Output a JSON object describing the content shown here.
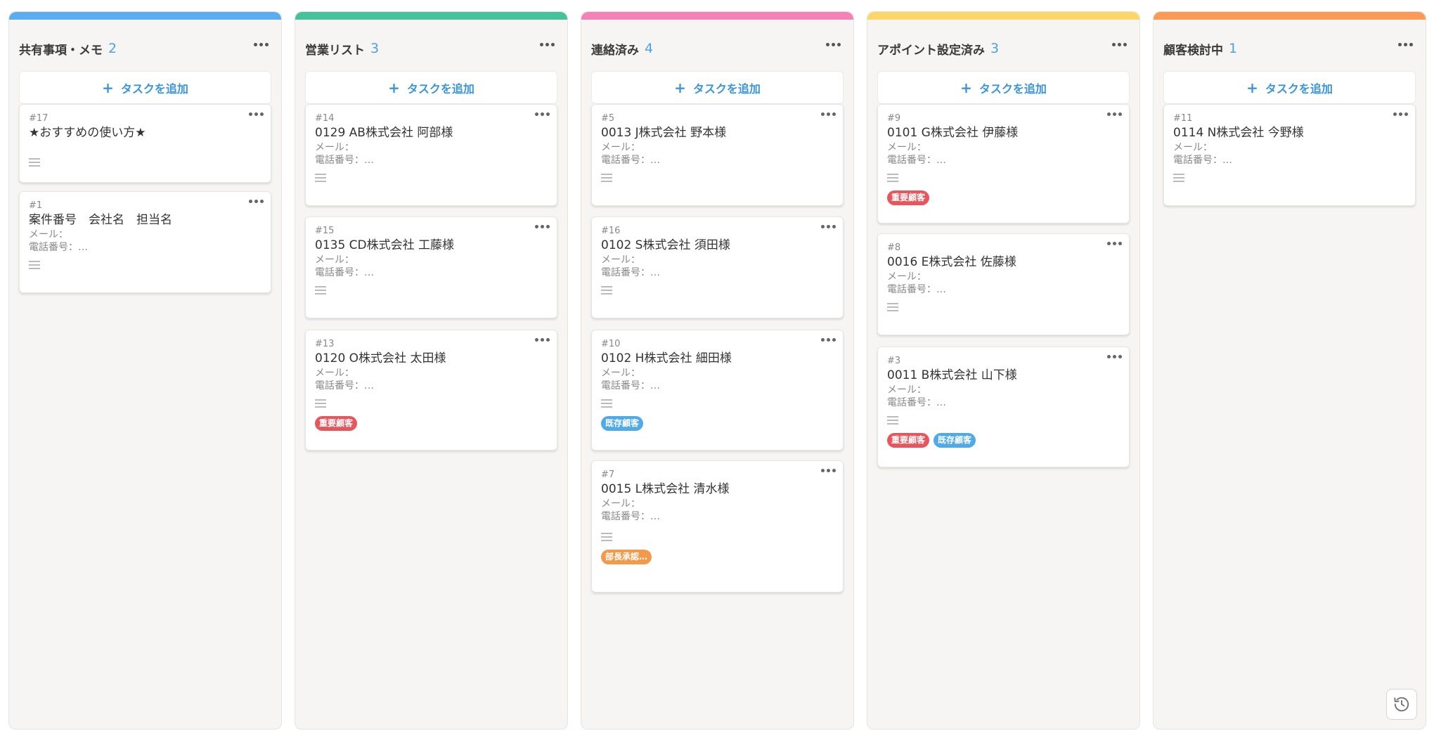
{
  "colors": {
    "blue": "#5aaef0",
    "green": "#45c29a",
    "pink": "#f482b6",
    "yellow": "#fcd766",
    "orange": "#fa9a55",
    "tag_red": "#e8565d",
    "tag_blue": "#4eaae8",
    "tag_orange": "#f39a4a"
  },
  "add_task_label": "タスクを追加",
  "icons": {
    "add": "plus-icon",
    "menu": "more-dots-icon",
    "checklist": "list-icon",
    "history": "history-icon"
  },
  "columns": [
    {
      "title": "共有事項・メモ",
      "count": "2",
      "cards": [
        {
          "id": "#17",
          "title": "★おすすめの使い方★",
          "fields": [],
          "tags": []
        },
        {
          "id": "#1",
          "title": "案件番号　会社名　担当名",
          "fields": [
            "メール：",
            "電話番号：…"
          ],
          "tags": []
        }
      ]
    },
    {
      "title": "営業リスト",
      "count": "3",
      "cards": [
        {
          "id": "#14",
          "title": "0129 AB株式会社 阿部様",
          "fields": [
            "メール：",
            "電話番号：…"
          ],
          "tags": []
        },
        {
          "id": "#15",
          "title": "0135 CD株式会社 工藤様",
          "fields": [
            "メール：",
            "電話番号：…"
          ],
          "tags": []
        },
        {
          "id": "#13",
          "title": "0120 O株式会社 太田様",
          "fields": [
            "メール：",
            "電話番号：…"
          ],
          "tags": [
            "重要顧客"
          ]
        }
      ]
    },
    {
      "title": "連絡済み",
      "count": "4",
      "cards": [
        {
          "id": "#5",
          "title": "0013 J株式会社 野本様",
          "fields": [
            "メール：",
            "電話番号：…"
          ],
          "tags": []
        },
        {
          "id": "#16",
          "title": "0102 S株式会社 須田様",
          "fields": [
            "メール：",
            "電話番号：…"
          ],
          "tags": []
        },
        {
          "id": "#10",
          "title": "0102 H株式会社 細田様",
          "fields": [
            "メール：",
            "電話番号：…"
          ],
          "tags": [
            "既存顧客"
          ]
        },
        {
          "id": "#7",
          "title": "0015 L株式会社 清水様",
          "fields": [
            "メール：",
            "電話番号：…"
          ],
          "tags": [
            "部長承認…"
          ]
        }
      ]
    },
    {
      "title": "アポイント設定済み",
      "count": "3",
      "cards": [
        {
          "id": "#9",
          "title": "0101 G株式会社 伊藤様",
          "fields": [
            "メール：",
            "電話番号：…"
          ],
          "tags": [
            "重要顧客"
          ]
        },
        {
          "id": "#8",
          "title": "0016 E株式会社 佐藤様",
          "fields": [
            "メール：",
            "電話番号：…"
          ],
          "tags": []
        },
        {
          "id": "#3",
          "title": "0011 B株式会社 山下様",
          "fields": [
            "メール：",
            "電話番号：…"
          ],
          "tags": [
            "重要顧客",
            "既存顧客"
          ]
        }
      ]
    },
    {
      "title": "顧客検討中",
      "count": "1",
      "cards": [
        {
          "id": "#11",
          "title": "0114 N株式会社 今野様",
          "fields": [
            "メール：",
            "電話番号：…"
          ],
          "tags": []
        }
      ]
    }
  ]
}
